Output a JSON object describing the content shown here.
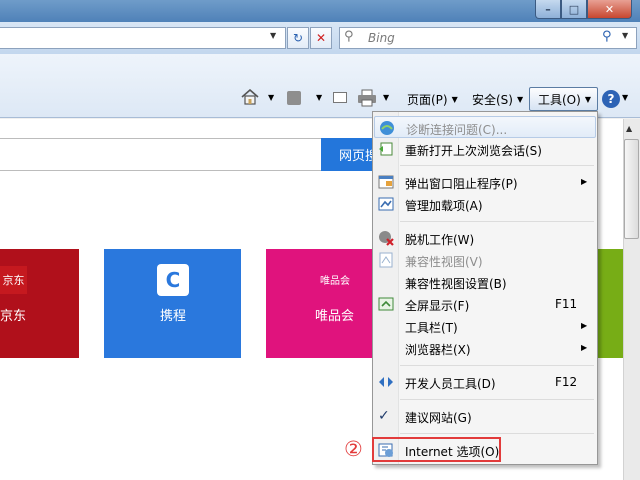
{
  "window": {
    "minimize_glyph": "–",
    "maximize_glyph": "□",
    "close_glyph": "✕"
  },
  "navbar": {
    "search_placeholder": "Bing",
    "refresh_icon": "refresh-icon",
    "stop_icon": "stop-icon"
  },
  "commandbar": {
    "page_label": "页面(P)",
    "safety_label": "安全(S)",
    "tools_label": "工具(O)",
    "help_label": "?"
  },
  "content": {
    "search_button": "网页搜",
    "tiles": [
      {
        "logo": "京东",
        "label": "京东",
        "color": "#b0101b"
      },
      {
        "label": "携程",
        "color": "#2a78dd"
      },
      {
        "logo": "唯品会",
        "label": "唯品会",
        "color": "#e0137d"
      },
      {
        "color": "#77ad16"
      }
    ]
  },
  "tools_menu": {
    "items": [
      {
        "label": "诊断连接问题(C)...",
        "disabled": true,
        "icon": "diagnose-icon"
      },
      {
        "label": "重新打开上次浏览会话(S)",
        "icon": "reopen-session-icon"
      },
      {
        "label": "弹出窗口阻止程序(P)",
        "submenu": true,
        "icon": "popup-blocker-icon"
      },
      {
        "label": "管理加载项(A)",
        "icon": "addons-icon"
      },
      {
        "label": "脱机工作(W)",
        "icon": "offline-icon"
      },
      {
        "label": "兼容性视图(V)",
        "disabled": true,
        "icon": "compat-view-icon"
      },
      {
        "label": "兼容性视图设置(B)"
      },
      {
        "label": "全屏显示(F)",
        "shortcut": "F11",
        "icon": "fullscreen-icon"
      },
      {
        "label": "工具栏(T)",
        "submenu": true
      },
      {
        "label": "浏览器栏(X)",
        "submenu": true
      },
      {
        "label": "开发人员工具(D)",
        "shortcut": "F12",
        "icon": "devtools-icon"
      },
      {
        "label": "建议网站(G)",
        "icon": "checkmark-icon"
      },
      {
        "label": "Internet 选项(O)",
        "icon": "internet-options-icon"
      }
    ]
  },
  "annotation": {
    "callout_number": "②",
    "highlight_color": "#e23b3b"
  }
}
